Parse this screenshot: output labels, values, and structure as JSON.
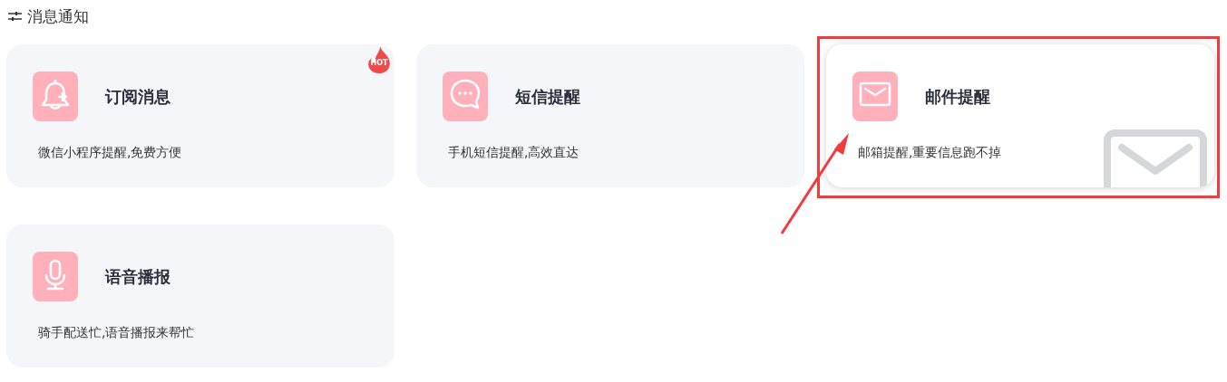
{
  "header": {
    "title": "消息通知"
  },
  "cards": [
    {
      "kind": "bell",
      "title": "订阅消息",
      "description": "微信小程序提醒,免费方便",
      "badge": "HOT",
      "highlighted": false
    },
    {
      "kind": "chat",
      "title": "短信提醒",
      "description": "手机短信提醒,高效直达",
      "highlighted": false
    },
    {
      "kind": "mail",
      "title": "邮件提醒",
      "description": "邮箱提醒,重要信息跑不掉",
      "highlighted": true
    },
    {
      "kind": "mic",
      "title": "语音播报",
      "description": "骑手配送忙,语音播报来帮忙",
      "highlighted": false
    }
  ]
}
